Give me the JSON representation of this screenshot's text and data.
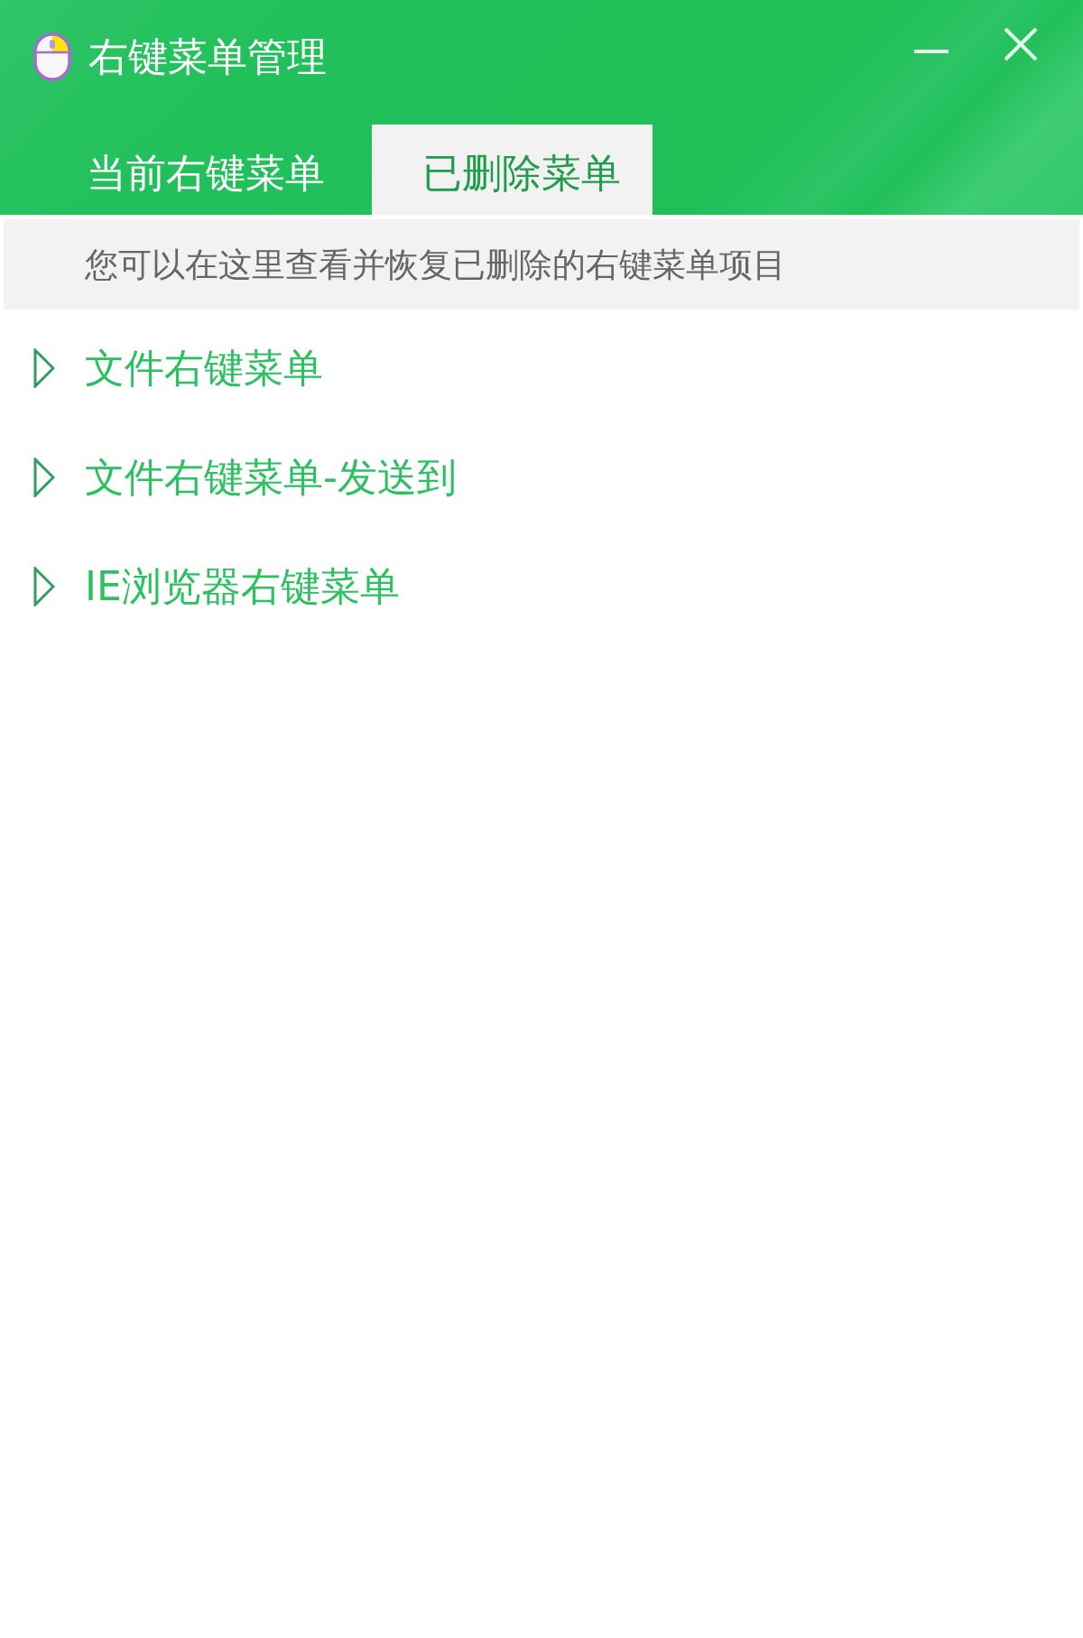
{
  "window": {
    "title": "右键菜单管理"
  },
  "tabs": [
    {
      "label": "当前右键菜单",
      "selected": false
    },
    {
      "label": "已删除菜单",
      "selected": true
    }
  ],
  "notice": "您可以在这里查看并恢复已删除的右键菜单项目",
  "tree": [
    {
      "label": "文件右键菜单",
      "expanded": false
    },
    {
      "label": "文件右键菜单-发送到",
      "expanded": false
    },
    {
      "label": "IE浏览器右键菜单",
      "expanded": false
    }
  ]
}
